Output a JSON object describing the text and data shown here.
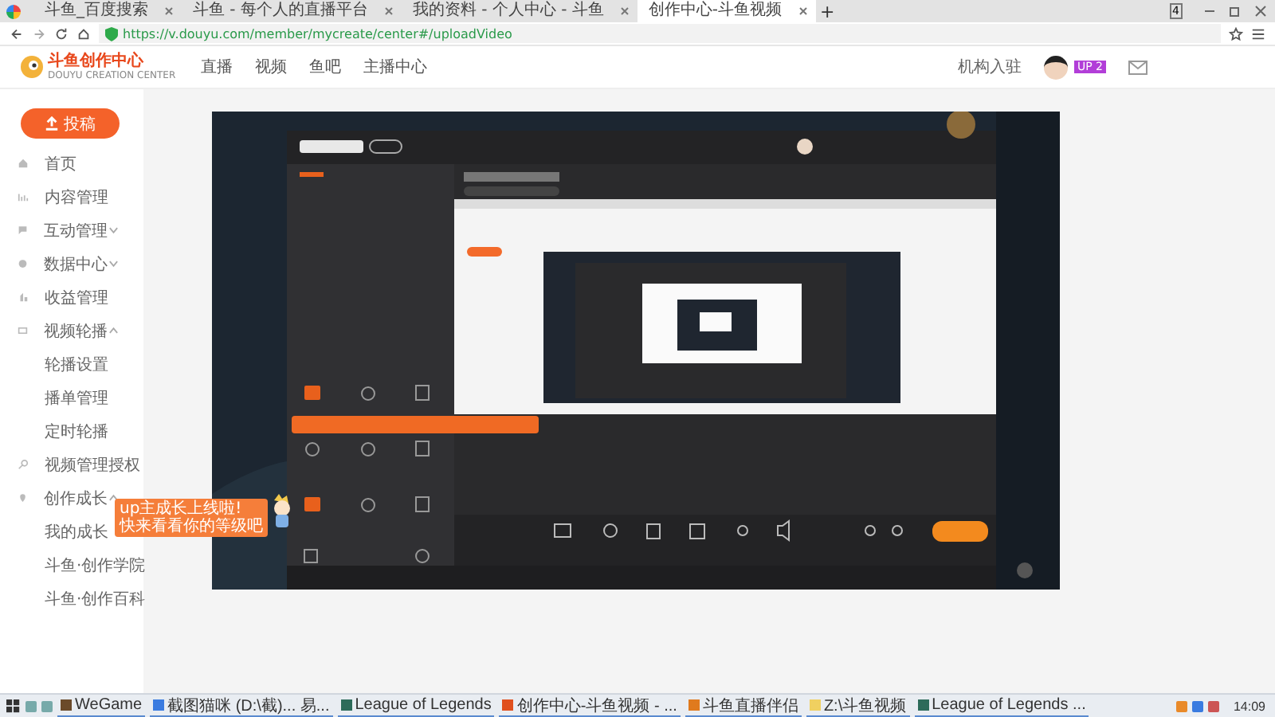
{
  "browser": {
    "tabs": [
      {
        "title": "斗鱼_百度搜索",
        "selected": false
      },
      {
        "title": "斗鱼 - 每个人的直播平台",
        "selected": false
      },
      {
        "title": "我的资料 - 个人中心 - 斗鱼",
        "selected": false
      },
      {
        "title": "创作中心-斗鱼视频",
        "selected": true
      }
    ],
    "new_tab": "+",
    "window_count": "4",
    "url": "https://v.douyu.com/member/mycreate/center#/uploadVideo"
  },
  "header": {
    "logo": "斗鱼创作中心",
    "logo_subtitle": "DOUYU CREATION CENTER",
    "nav": [
      "直播",
      "视频",
      "鱼吧",
      "主播中心"
    ],
    "org_link": "机构入驻",
    "level_badge": "UP 2"
  },
  "sidebar": {
    "upload_button": "投稿",
    "items": [
      {
        "label": "首页",
        "kind": "link"
      },
      {
        "label": "内容管理",
        "kind": "link"
      },
      {
        "label": "互动管理",
        "kind": "group",
        "expanded": false
      },
      {
        "label": "数据中心",
        "kind": "group",
        "expanded": false
      },
      {
        "label": "收益管理",
        "kind": "link"
      },
      {
        "label": "视频轮播",
        "kind": "group",
        "expanded": true,
        "children": [
          {
            "label": "轮播设置"
          },
          {
            "label": "播单管理"
          },
          {
            "label": "定时轮播"
          }
        ]
      },
      {
        "label": "视频管理授权",
        "kind": "link"
      },
      {
        "label": "创作成长",
        "kind": "group",
        "expanded": true,
        "children": [
          {
            "label": "我的成长"
          },
          {
            "label": "斗鱼·创作学院"
          },
          {
            "label": "斗鱼·创作百科"
          }
        ]
      }
    ],
    "tooltip": [
      "up主成长上线啦!",
      "快来看看你的等级吧"
    ]
  },
  "taskbar": {
    "items": [
      {
        "label": "WeGame",
        "color": "#6b4a2a"
      },
      {
        "label": "截图猫咪 (D:\\截)... 易...",
        "color": "#3a7be0"
      },
      {
        "label": "League of Legends",
        "color": "#2d6b5a"
      },
      {
        "label": "创作中心-斗鱼视频 - ...",
        "color": "#e0501e"
      },
      {
        "label": "斗鱼直播伴侣",
        "color": "#e07a1e"
      },
      {
        "label": "Z:\\斗鱼视频",
        "color": "#f0d060"
      },
      {
        "label": "League of Legends ...",
        "color": "#2d6b5a"
      }
    ],
    "clock": "14:09"
  }
}
